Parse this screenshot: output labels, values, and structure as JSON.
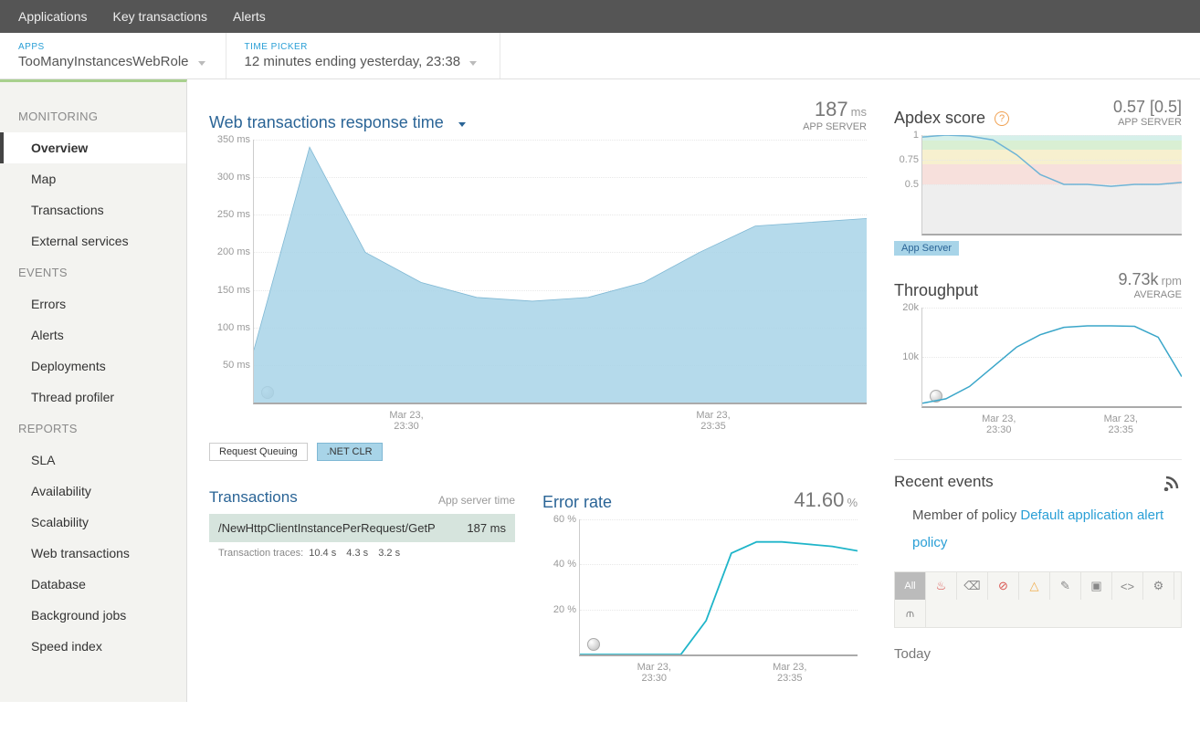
{
  "topnav": {
    "items": [
      "Applications",
      "Key transactions",
      "Alerts"
    ]
  },
  "pickers": {
    "apps": {
      "label": "APPS",
      "value": "TooManyInstancesWebRole"
    },
    "time": {
      "label": "TIME PICKER",
      "value": "12 minutes ending yesterday, 23:38"
    }
  },
  "sidebar": {
    "groups": [
      {
        "label": "MONITORING",
        "items": [
          "Overview",
          "Map",
          "Transactions",
          "External services"
        ],
        "activeIndex": 0
      },
      {
        "label": "EVENTS",
        "items": [
          "Errors",
          "Alerts",
          "Deployments",
          "Thread profiler"
        ]
      },
      {
        "label": "REPORTS",
        "items": [
          "SLA",
          "Availability",
          "Scalability",
          "Web transactions",
          "Database",
          "Background jobs",
          "Speed index"
        ]
      }
    ]
  },
  "responseChart": {
    "title": "Web transactions response time",
    "value": "187",
    "unit": "ms",
    "sub": "APP SERVER",
    "legend": [
      "Request Queuing",
      ".NET CLR"
    ]
  },
  "apdex": {
    "title": "Apdex score",
    "value": "0.57 [0.5]",
    "sub": "APP SERVER",
    "pill": "App Server"
  },
  "throughput": {
    "title": "Throughput",
    "value": "9.73k",
    "unit": "rpm",
    "sub": "AVERAGE"
  },
  "transactions": {
    "title": "Transactions",
    "sub": "App server time",
    "row": {
      "name": "/NewHttpClientInstancePerRequest/GetP",
      "time": "187 ms"
    },
    "traces": {
      "label": "Transaction traces:",
      "values": [
        "10.4 s",
        "4.3 s",
        "3.2 s"
      ]
    }
  },
  "errorRate": {
    "title": "Error rate",
    "value": "41.60",
    "unit": "%"
  },
  "recent": {
    "title": "Recent events",
    "policyPrefix": "Member of policy ",
    "policyLink": "Default application alert policy",
    "allLabel": "All",
    "today": "Today"
  },
  "xTicks": [
    "Mar 23,\n23:30",
    "Mar 23,\n23:35"
  ],
  "chart_data": [
    {
      "type": "area",
      "title": "Web transactions response time",
      "ylabel": "ms",
      "ylim": [
        0,
        350
      ],
      "yticks": [
        50,
        100,
        150,
        200,
        250,
        300,
        350
      ],
      "x": [
        "23:27",
        "23:28",
        "23:29",
        "23:30",
        "23:31",
        "23:32",
        "23:33",
        "23:34",
        "23:35",
        "23:36",
        "23:37",
        "23:38"
      ],
      "values": [
        70,
        340,
        200,
        160,
        140,
        135,
        140,
        160,
        200,
        235,
        240,
        245
      ]
    },
    {
      "type": "line",
      "title": "Apdex score",
      "ylim": [
        0,
        1
      ],
      "yticks": [
        0.5,
        0.75,
        1
      ],
      "x": [
        "23:27",
        "23:28",
        "23:29",
        "23:30",
        "23:31",
        "23:32",
        "23:33",
        "23:34",
        "23:35",
        "23:36",
        "23:37",
        "23:38"
      ],
      "values": [
        0.98,
        1.0,
        0.99,
        0.95,
        0.8,
        0.6,
        0.5,
        0.5,
        0.48,
        0.5,
        0.5,
        0.52
      ],
      "bands": [
        {
          "from": 0.94,
          "to": 1.0,
          "name": "excellent",
          "color": "#d6f0ea"
        },
        {
          "from": 0.85,
          "to": 0.94,
          "name": "good",
          "color": "#d9efd3"
        },
        {
          "from": 0.7,
          "to": 0.85,
          "name": "fair",
          "color": "#f7f0cf"
        },
        {
          "from": 0.5,
          "to": 0.7,
          "name": "poor",
          "color": "#f7e0dc"
        },
        {
          "from": 0.0,
          "to": 0.5,
          "name": "unacceptable",
          "color": "#eeeeee"
        }
      ]
    },
    {
      "type": "line",
      "title": "Throughput",
      "ylabel": "rpm",
      "ylim": [
        0,
        20000
      ],
      "yticks": [
        10000,
        20000
      ],
      "x": [
        "23:27",
        "23:28",
        "23:29",
        "23:30",
        "23:31",
        "23:32",
        "23:33",
        "23:34",
        "23:35",
        "23:36",
        "23:37",
        "23:38"
      ],
      "values": [
        600,
        1500,
        4000,
        8000,
        12000,
        14500,
        16000,
        16300,
        16300,
        16200,
        14000,
        6000
      ]
    },
    {
      "type": "line",
      "title": "Error rate",
      "ylabel": "%",
      "ylim": [
        0,
        60
      ],
      "yticks": [
        20,
        40,
        60
      ],
      "x": [
        "23:27",
        "23:28",
        "23:29",
        "23:30",
        "23:31",
        "23:32",
        "23:33",
        "23:34",
        "23:35",
        "23:36",
        "23:37",
        "23:38"
      ],
      "values": [
        0,
        0,
        0,
        0,
        0,
        15,
        45,
        50,
        50,
        49,
        48,
        46
      ]
    }
  ]
}
